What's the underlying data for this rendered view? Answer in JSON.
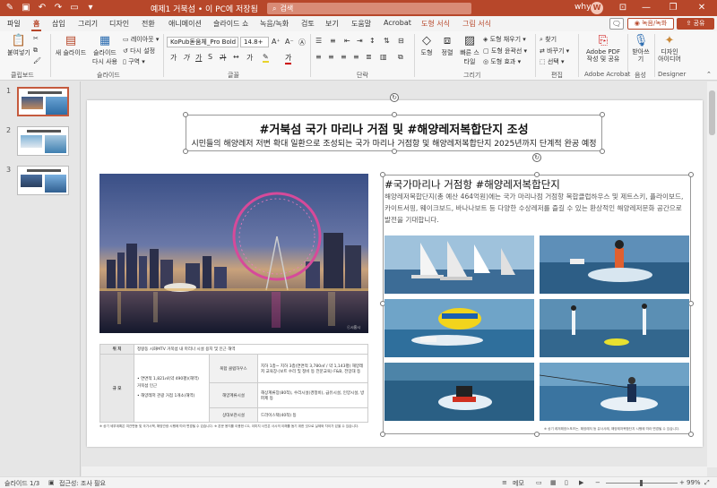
{
  "window": {
    "doc_title": "예제1 거북섬 • 이 PC에 저장됨",
    "search_placeholder": "검색",
    "user_name": "why",
    "avatar_initial": "W",
    "accent": "#b7472a"
  },
  "ribbon_tabs": [
    "파일",
    "홈",
    "삽입",
    "그리기",
    "디자인",
    "전환",
    "애니메이션",
    "슬라이드 쇼",
    "녹음/녹화",
    "검토",
    "보기",
    "도움말",
    "Acrobat",
    "도형 서식",
    "그림 서식"
  ],
  "ribbon_right": {
    "record": "녹음/녹화",
    "share": "공유"
  },
  "ribbon": {
    "clipboard": {
      "paste": "붙여넣기",
      "label": "클립보드"
    },
    "slides": {
      "new_slide": "새 슬라이드",
      "reuse": "슬라이드 다시 사용",
      "layout": "레이아웃",
      "reset": "다시 설정",
      "section": "구역",
      "label": "슬라이드"
    },
    "font": {
      "family": "KoPub돋움체_Pro Bold",
      "size": "14.8+",
      "label": "글꼴"
    },
    "paragraph": {
      "label": "단락"
    },
    "drawing": {
      "shapes": "도형",
      "arrange": "정렬",
      "quick_styles": "빠른 스타일",
      "fill": "도형 채우기",
      "outline": "도형 윤곽선",
      "effects": "도형 효과",
      "label": "그리기"
    },
    "editing": {
      "find": "찾기",
      "replace": "바꾸기",
      "select": "선택",
      "label": "편집"
    },
    "acrobat": {
      "create": "Adobe PDF 작성 및 공유",
      "label": "Adobe Acrobat"
    },
    "voice": {
      "dictate": "받아쓰기",
      "label": "음성"
    },
    "designer": {
      "ideas": "디자인 아이디어",
      "label": "Designer"
    }
  },
  "thumbnails": [
    "1",
    "2",
    "3"
  ],
  "slide": {
    "title": "#거북섬 국가 마리나 거점 및 #해양레저복합단지 조성",
    "subtitle": "시민들의 해양레저 저변 확대 일환으로 조성되는 국가 마리나 거점항 및 해양레저복합단지 2025년까지 단계적 완공 예정",
    "photo_credit": "ⓒ시흥시",
    "content_heading": "#국가마리나 거점항 #해양레저복합단지",
    "content_body": "해양레저복합단지(총 예산 464억원)에는 국가 마리나점 거점항 복합클럽하우스 및 제트스키, 플라이보드, 카이트서핑, 웨이크보드, 바나나보트 등 다양한 수상레저를 즐길 수 있는 환상적인 해양레저문화 공간으로 발전을 기대합니다.",
    "pic_note": "※ 상기 레저해양스포츠는, 해양레저 등 유사사례, 해양레저복합단지 시행에 따라 변경될 수 있습니다.",
    "table": {
      "loc_label": "위  치",
      "loc_value": "정왕동 시화MTV 거북섬 내 마리나 시설 용지 및 인근 해역",
      "scale_label": "규  모",
      "scale_left": [
        "• 연면적 1,821㎡(약 490평)(해역)",
        "  거북섬 인근",
        "• 해양레저 관광 거점 1개소(해역)"
      ],
      "rows": [
        {
          "label": "복합 클럽하우스",
          "value": "지하 1층~ 지하 3층(연면적 3,780㎡ / 약 1,143평) 해양레저 교육장·(보트 수리 및 정비 등 전문교육) F&B, 전망대 등"
        },
        {
          "label": "해양계류시설",
          "value": "해상계류장(80척), 수리시설(경정비), 급유시설, 인양시설, 방파제 등"
        },
        {
          "label": "상대보관시설",
          "value": "드라이스택(40척) 등"
        }
      ],
      "note": "※ 상기 세부계획은 여건변동 및 국가시책, 해양관광 시행에 따라 변경될 수 있습니다. ※ 본문 용지를 이용한 CG, 이미지 사진은 사시의 이해를 돕기 위한 것으로 실제와 차이가 있을 수 있습니다."
    }
  },
  "statusbar": {
    "slide_info": "슬라이드 1/3",
    "accessibility": "접근성: 조사 필요",
    "notes": "메모",
    "zoom": "99%"
  }
}
